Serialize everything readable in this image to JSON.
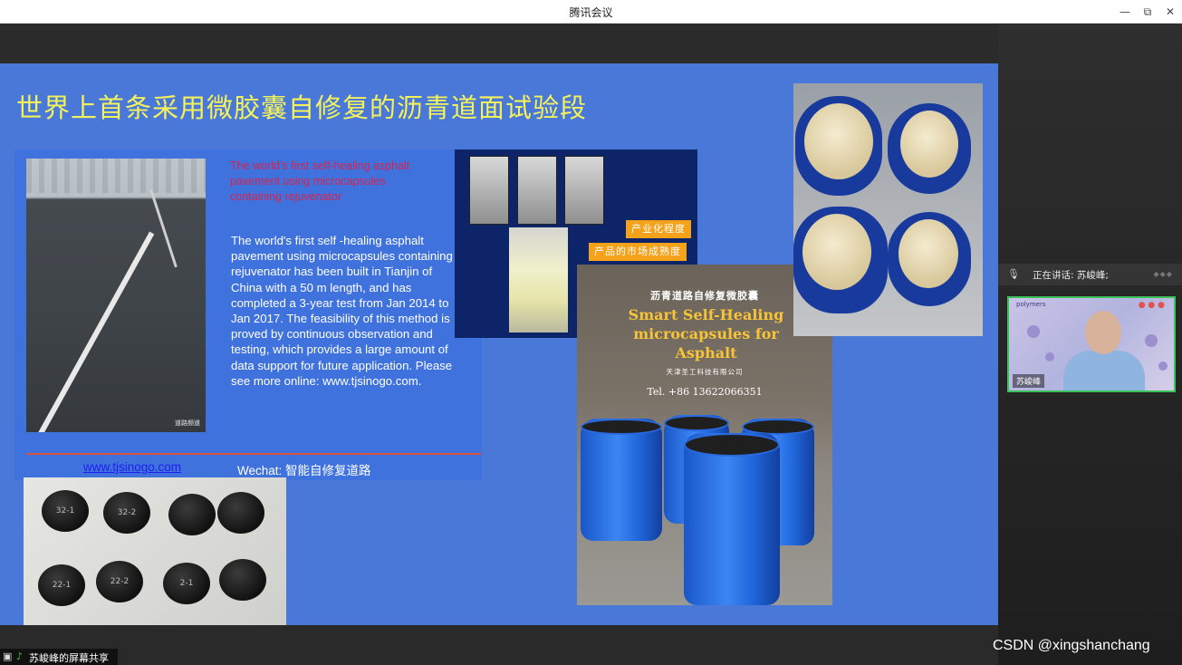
{
  "window": {
    "title": "腾讯会议",
    "controls": {
      "minimize": "—",
      "restore": "⧉",
      "close": "✕"
    }
  },
  "slide": {
    "title": "世界上首条采用微胶囊自修复的沥青道面试验段",
    "red_text": "The world's first self-healing asphalt pavement using microcapsules containing rejuvenator",
    "body_text": "The world's first self -healing asphalt pavement using microcapsules containing rejuvenator has been built in Tianjin of China with a 50 m length, and has completed a 3-year test from Jan 2014 to Jan 2017. The feasibility of this method is proved by continuous observation and testing, which provides a large amount of data support for future application. Please see more online: www.tjsinogo.com.",
    "website": "www.tjsinogo.com",
    "wechat": "Wechat: 智能自修复道路",
    "road_badge": "道路频道",
    "samples": [
      "32-1",
      "32-2",
      "",
      "",
      "22-1",
      "22-2",
      "2-1",
      ""
    ],
    "tags": [
      "产业化程度",
      "产品的市场成熟度"
    ],
    "poster": {
      "cn_title": "沥青道路自修复微胶囊",
      "en_title": "Smart Self-Healing microcapsules for Asphalt",
      "company": "天津圣工科技有限公司",
      "tel": "Tel. +86 13622066351"
    }
  },
  "sidebar": {
    "speaking_label": "正在讲话: 苏峻峰;",
    "participant_name": "苏峻峰",
    "video_banner": "polymers"
  },
  "share_status": "苏峻峰的屏幕共享",
  "watermark": "CSDN @xingshanchang",
  "colors": {
    "slide_bg": "#4a78d8",
    "title_yellow": "#f4f25a",
    "red_text": "#d8234f",
    "link_blue": "#1e1ef0",
    "tag_orange": "#f5a21b",
    "speaker_border": "#3cc15b"
  }
}
